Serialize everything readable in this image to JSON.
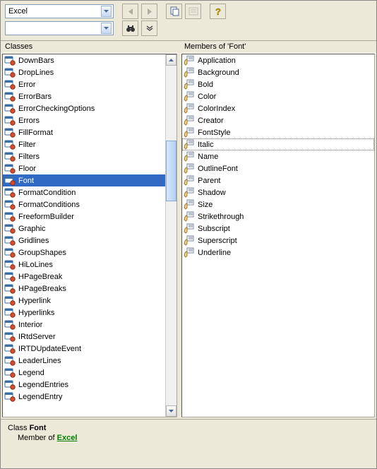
{
  "toolbar": {
    "library_combo": {
      "value": "Excel"
    },
    "search_combo": {
      "value": ""
    },
    "buttons": {
      "back": "back",
      "forward": "forward",
      "copy": "copy",
      "view_def": "view-definition",
      "help": "help",
      "find": "find",
      "settings": "settings"
    }
  },
  "classes": {
    "header": "Classes",
    "selected": "Font",
    "items": [
      "DownBars",
      "DropLines",
      "Error",
      "ErrorBars",
      "ErrorCheckingOptions",
      "Errors",
      "FillFormat",
      "Filter",
      "Filters",
      "Floor",
      "Font",
      "FormatCondition",
      "FormatConditions",
      "FreeformBuilder",
      "Graphic",
      "Gridlines",
      "GroupShapes",
      "HiLoLines",
      "HPageBreak",
      "HPageBreaks",
      "Hyperlink",
      "Hyperlinks",
      "Interior",
      "IRtdServer",
      "IRTDUpdateEvent",
      "LeaderLines",
      "Legend",
      "LegendEntries",
      "LegendEntry"
    ]
  },
  "members": {
    "header": "Members of 'Font'",
    "focused": "Italic",
    "items": [
      "Application",
      "Background",
      "Bold",
      "Color",
      "ColorIndex",
      "Creator",
      "FontStyle",
      "Italic",
      "Name",
      "OutlineFont",
      "Parent",
      "Shadow",
      "Size",
      "Strikethrough",
      "Subscript",
      "Superscript",
      "Underline"
    ]
  },
  "footer": {
    "prefix": "Class ",
    "classname": "Font",
    "member_prefix": "Member of ",
    "link": "Excel"
  }
}
